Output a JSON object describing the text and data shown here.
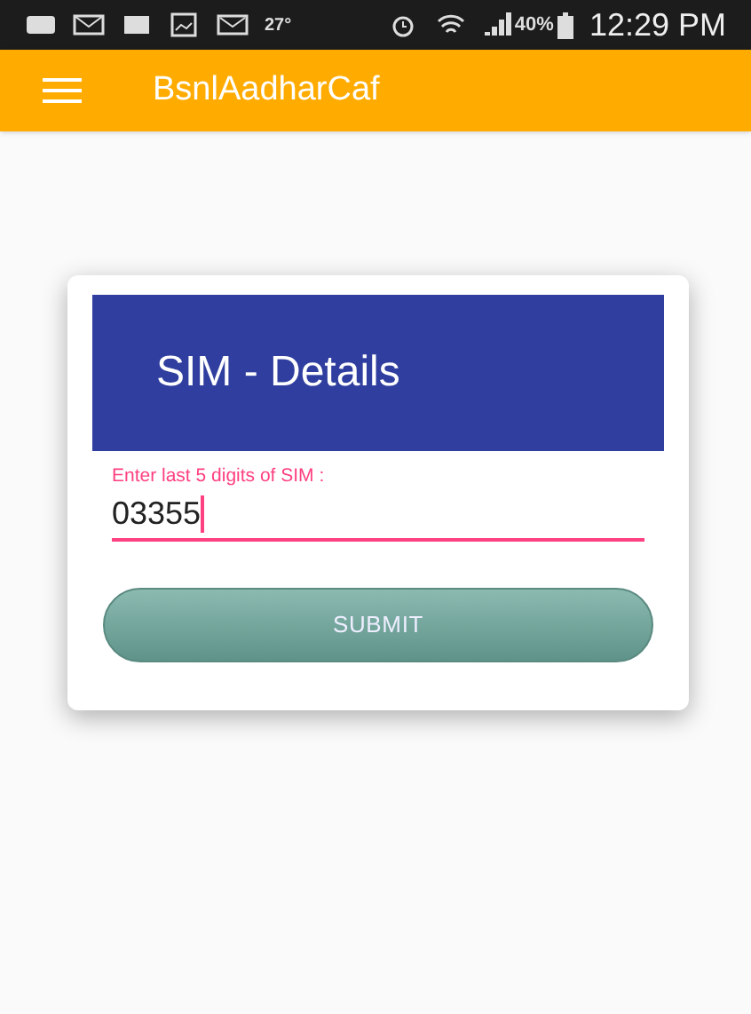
{
  "status_bar": {
    "temperature": "27°",
    "battery": "40%",
    "time": "12:29 PM"
  },
  "app_bar": {
    "title": "BsnlAadharCaf"
  },
  "card": {
    "title": "SIM - Details",
    "field": {
      "label": "Enter last 5 digits of SIM :",
      "value": "03355",
      "focused": true
    },
    "button": "SUBMIT"
  }
}
